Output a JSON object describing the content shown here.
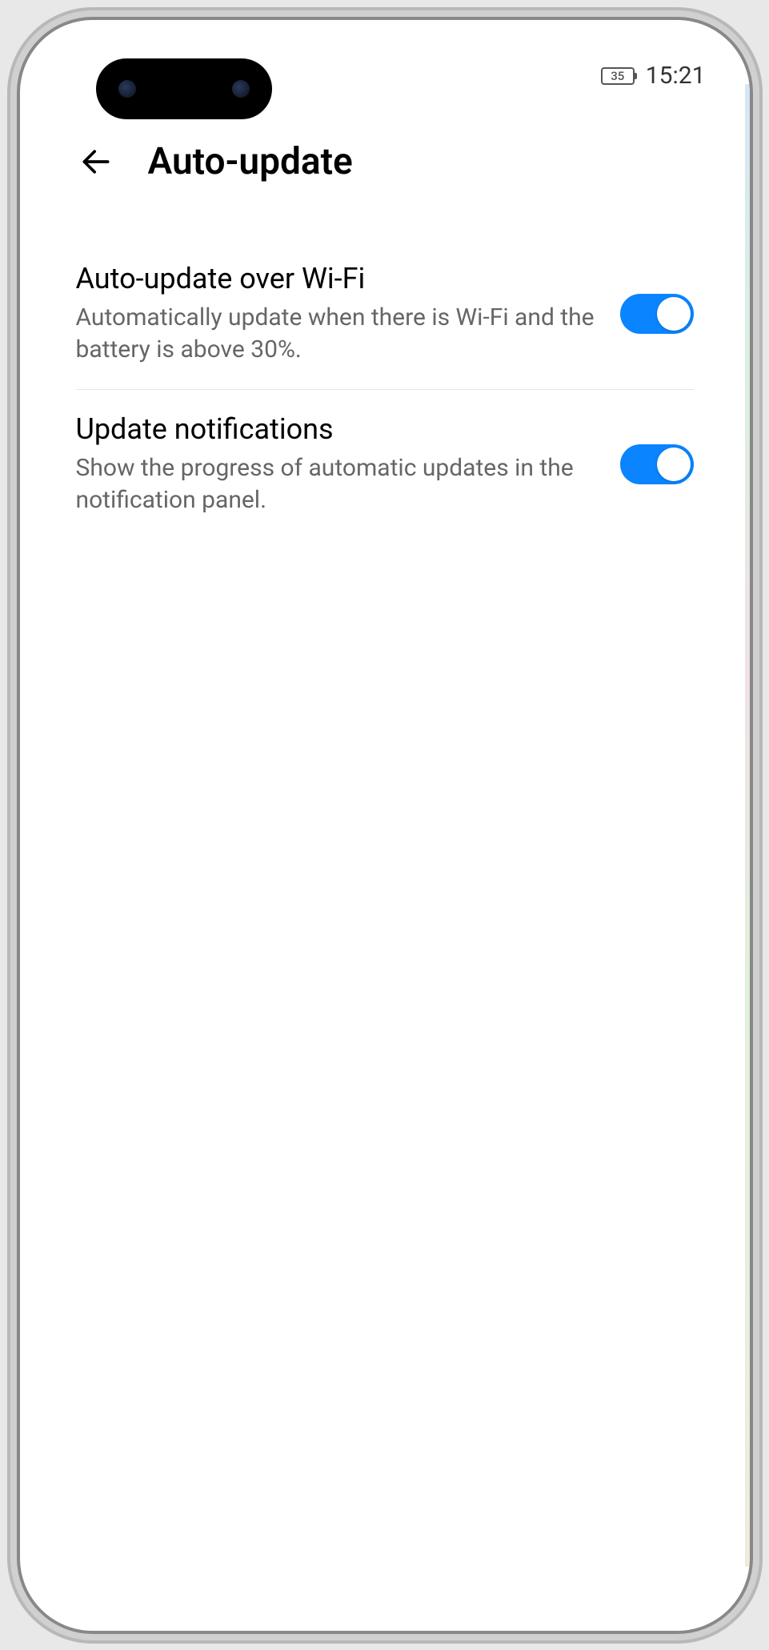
{
  "status_bar": {
    "battery_level": "35",
    "time": "15:21"
  },
  "header": {
    "title": "Auto-update"
  },
  "settings": [
    {
      "title": "Auto-update over Wi-Fi",
      "description": "Automatically update when there is Wi-Fi and the battery is above 30%.",
      "enabled": true
    },
    {
      "title": "Update notifications",
      "description": "Show the progress of automatic updates in the notification panel.",
      "enabled": true
    }
  ]
}
